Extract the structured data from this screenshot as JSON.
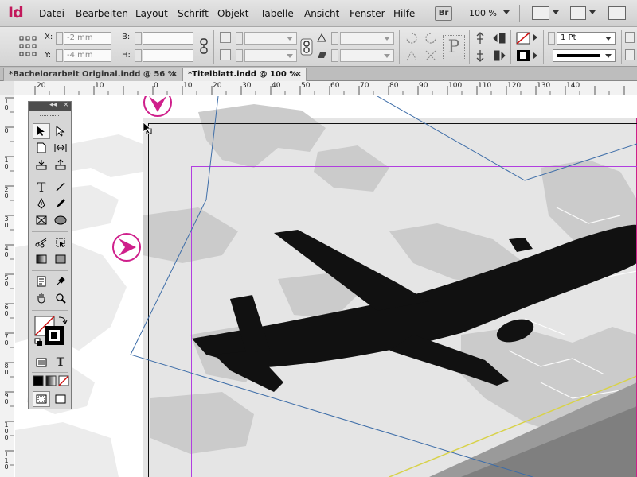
{
  "app": {
    "logo": "Id"
  },
  "menu": {
    "items": [
      "Datei",
      "Bearbeiten",
      "Layout",
      "Schrift",
      "Objekt",
      "Tabelle",
      "Ansicht",
      "Fenster",
      "Hilfe"
    ],
    "bridge_label": "Br",
    "zoom": "100 %"
  },
  "control": {
    "x_label": "X:",
    "x_value": "-2 mm",
    "y_label": "Y:",
    "y_value": "-4 mm",
    "w_label": "B:",
    "h_label": "H:",
    "stroke_weight": "1 Pt",
    "p_glyph": "P"
  },
  "tabs": [
    {
      "label": "*Bachelorarbeit Original.indd @ 56 %",
      "close": "×"
    },
    {
      "label": "*Titelblatt.indd @ 100 %",
      "close": "×"
    }
  ],
  "ruler": {
    "h_labels": [
      "20",
      "10",
      "0",
      "10",
      "20",
      "30",
      "40",
      "50",
      "60",
      "70",
      "80",
      "90",
      "100",
      "110",
      "120",
      "130",
      "140"
    ],
    "v_labels": [
      "1 0",
      "0",
      "1 0",
      "2 0",
      "3 0",
      "4 0",
      "5 0",
      "6 0",
      "7 0",
      "8 0",
      "9 0",
      "1 0 0",
      "1 1 0"
    ]
  },
  "toolbox": {
    "collapse_glyph": "◂◂",
    "close_glyph": "×",
    "type_tool_glyph": "T",
    "text_format_glyph": "T"
  },
  "colors": {
    "accent": "#c2185b",
    "bleed_guide": "#cf1f8b",
    "margin_guide": "#b13ee0",
    "frame_path": "#3d6da8",
    "airplane": "#111111",
    "map_grey": "#c8c8c8"
  }
}
